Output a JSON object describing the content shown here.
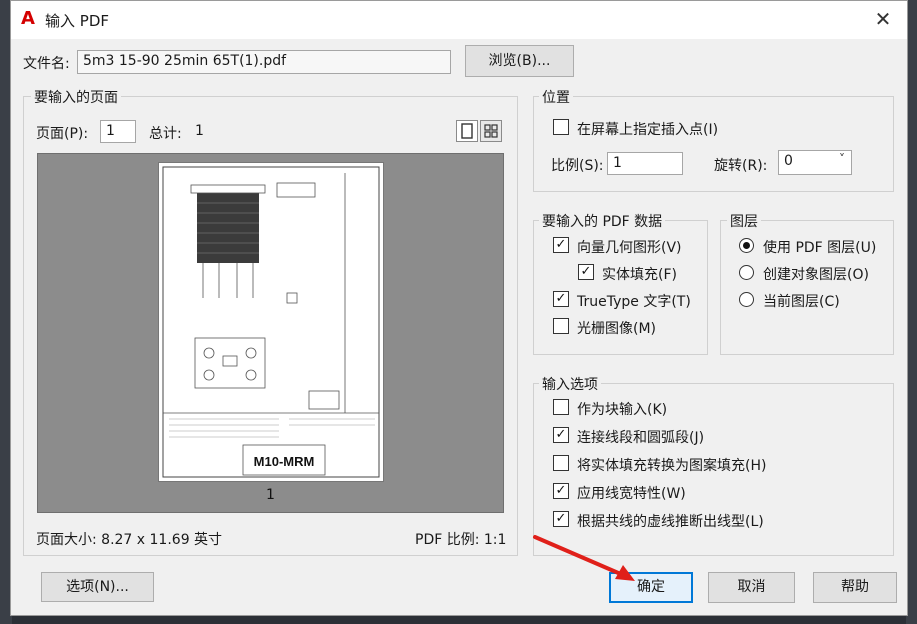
{
  "dialog": {
    "title": "输入 PDF",
    "close_glyph": "✕"
  },
  "file": {
    "label": "文件名:",
    "value": "5m3 15-90 25min  65T(1).pdf",
    "browse_button": "浏览(B)..."
  },
  "pages": {
    "group_title": "要输入的页面",
    "page_label": "页面(P):",
    "page_value": "1",
    "total_label": "总计:",
    "total_value": "1",
    "preview_page_number": "1",
    "page_size_label": "页面大小: 8.27 x 11.69 英寸",
    "pdf_scale_label": "PDF 比例: 1:1",
    "drawing_title": "M10-MRM"
  },
  "position": {
    "group_title": "位置",
    "specify_on_screen": "在屏幕上指定插入点(I)",
    "specify_checked": false,
    "scale_label": "比例(S):",
    "scale_value": "1",
    "rotation_label": "旋转(R):",
    "rotation_value": "0"
  },
  "pdf_data": {
    "group_title": "要输入的 PDF 数据",
    "items": [
      {
        "label": "向量几何图形(V)",
        "checked": true
      },
      {
        "label": "实体填充(F)",
        "checked": true
      },
      {
        "label": "TrueType 文字(T)",
        "checked": true
      },
      {
        "label": "光栅图像(M)",
        "checked": false
      }
    ]
  },
  "layers": {
    "group_title": "图层",
    "items": [
      {
        "label": "使用 PDF 图层(U)",
        "selected": true
      },
      {
        "label": "创建对象图层(O)",
        "selected": false
      },
      {
        "label": "当前图层(C)",
        "selected": false
      }
    ]
  },
  "import_options": {
    "group_title": "输入选项",
    "items": [
      {
        "label": "作为块输入(K)",
        "checked": false
      },
      {
        "label": "连接线段和圆弧段(J)",
        "checked": true
      },
      {
        "label": "将实体填充转换为图案填充(H)",
        "checked": false
      },
      {
        "label": "应用线宽特性(W)",
        "checked": true
      },
      {
        "label": "根据共线的虚线推断出线型(L)",
        "checked": true
      }
    ]
  },
  "footer": {
    "options_button": "选项(N)...",
    "ok_button": "确定",
    "cancel_button": "取消",
    "help_button": "帮助"
  },
  "colors": {
    "accent": "#0078d7",
    "arrow": "#e0201a",
    "app_icon": "#d40000"
  },
  "icons": {
    "single_view": "single-page-view-icon",
    "grid_view": "grid-view-icon"
  }
}
